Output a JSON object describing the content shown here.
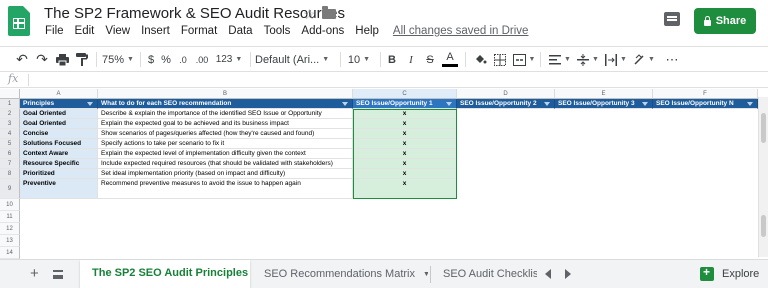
{
  "app": {
    "title": "The SP2 Framework & SEO Audit Resources",
    "saved_status": "All changes saved in Drive",
    "share_label": "Share"
  },
  "menu": [
    "File",
    "Edit",
    "View",
    "Insert",
    "Format",
    "Data",
    "Tools",
    "Add-ons",
    "Help"
  ],
  "toolbar": {
    "zoom": "75%",
    "currency": "$",
    "percent": "%",
    "dec_less": ".0",
    "dec_more": ".00",
    "more_formats": "123",
    "font": "Default (Ari...",
    "font_size": "10",
    "bold": "B",
    "italic": "I",
    "strike": "S",
    "text_color": "A"
  },
  "formula_bar": {
    "fx": "fx",
    "value": ""
  },
  "columns": [
    "A",
    "B",
    "C",
    "D",
    "E",
    "F"
  ],
  "rows": [
    "1",
    "2",
    "3",
    "4",
    "5",
    "6",
    "7",
    "8",
    "9",
    "10",
    "11",
    "12",
    "13",
    "14"
  ],
  "table": {
    "headers": [
      "Principles",
      "What to do for each SEO recommendation",
      "SEO Issue/Opportunity 1",
      "SEO Issue/Opportunity 2",
      "SEO Issue/Opportunity 3",
      "SEO Issue/Opportunity N"
    ],
    "body": [
      [
        "Goal Oriented",
        "Describe & explain the importance of the identified SEO Issue or Opportunity",
        "x"
      ],
      [
        "Goal Oriented",
        "Explain the expected goal to be achieved and its business impact",
        "x"
      ],
      [
        "Concise",
        "Show scenarios of pages/queries affected (how they're caused and found)",
        "x"
      ],
      [
        "Solutions Focused",
        "Specify actions to take per scenario to fix it",
        "x"
      ],
      [
        "Context Aware",
        "Explain the expected level of implementation difficulty given the context",
        "x"
      ],
      [
        "Resource Specific",
        "Include expected required resources (that should be validated with stakeholders)",
        "x"
      ],
      [
        "Prioritized",
        "Set ideal implementation priority (based on impact and difficulty)",
        "x"
      ],
      [
        "Preventive",
        "Recommend preventive measures to avoid the issue to happen again",
        "x"
      ]
    ]
  },
  "sheets": {
    "add": "+",
    "tabs": [
      "The SP2 SEO Audit Principles",
      "SEO Recommendations Matrix",
      "SEO Audit Checklis"
    ],
    "explore": "Explore"
  },
  "colors": {
    "header_blue": "#1f5c9c",
    "principle_bg": "#dbe9f7",
    "selected_col_bg": "#d6efdd",
    "share_green": "#1e8e3e",
    "active_tab_green": "#188038"
  },
  "icons": [
    "sheets-logo-icon",
    "star-icon",
    "folder-icon",
    "comment-icon",
    "lock-icon",
    "undo-icon",
    "redo-icon",
    "print-icon",
    "paint-format-icon",
    "fill-color-icon",
    "borders-icon",
    "merge-icon",
    "align-icon",
    "valign-icon",
    "wrap-icon",
    "rotate-icon",
    "filter-icon",
    "explore-icon"
  ]
}
